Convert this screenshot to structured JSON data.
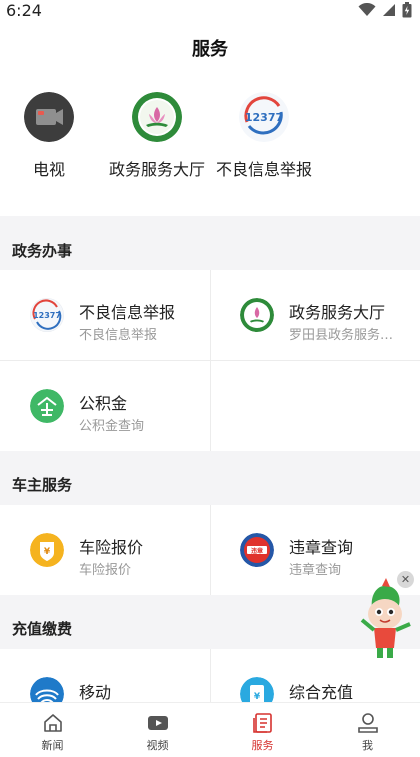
{
  "status_bar": {
    "time": "6:24"
  },
  "header": {
    "title": "服务"
  },
  "quick_services": [
    {
      "label": "电视",
      "icon": "tv-camera-icon"
    },
    {
      "label": "政务服务大厅",
      "icon": "government-hall-emblem-icon"
    },
    {
      "label": "不良信息举报",
      "icon": "report-12377-icon"
    }
  ],
  "sections": {
    "government": {
      "title": "政务办事",
      "items": [
        {
          "title": "不良信息举报",
          "subtitle": "不良信息举报",
          "icon": "report-12377-icon"
        },
        {
          "title": "政务服务大厅",
          "subtitle": "罗田县政务服务大厅",
          "icon": "government-hall-emblem-icon"
        },
        {
          "title": "公积金",
          "subtitle": "公积金查询",
          "icon": "housing-fund-icon"
        }
      ]
    },
    "car_owner": {
      "title": "车主服务",
      "items": [
        {
          "title": "车险报价",
          "subtitle": "车险报价",
          "icon": "car-insurance-icon"
        },
        {
          "title": "违章查询",
          "subtitle": "违章查询",
          "icon": "traffic-violation-icon"
        }
      ]
    },
    "recharge": {
      "title": "充值缴费",
      "items": [
        {
          "title": "移动",
          "icon": "china-mobile-icon"
        },
        {
          "title": "综合充值",
          "icon": "recharge-icon"
        }
      ]
    }
  },
  "bottom_nav": [
    {
      "label": "新闻",
      "icon": "home-icon",
      "active": false
    },
    {
      "label": "视频",
      "icon": "video-play-icon",
      "active": false
    },
    {
      "label": "服务",
      "icon": "service-list-icon",
      "active": true
    },
    {
      "label": "我",
      "icon": "user-icon",
      "active": false
    }
  ],
  "colors": {
    "accent": "#d6322f",
    "section_gap": "#f4f4f6",
    "divider": "#ececec",
    "subtitle": "#999999"
  }
}
